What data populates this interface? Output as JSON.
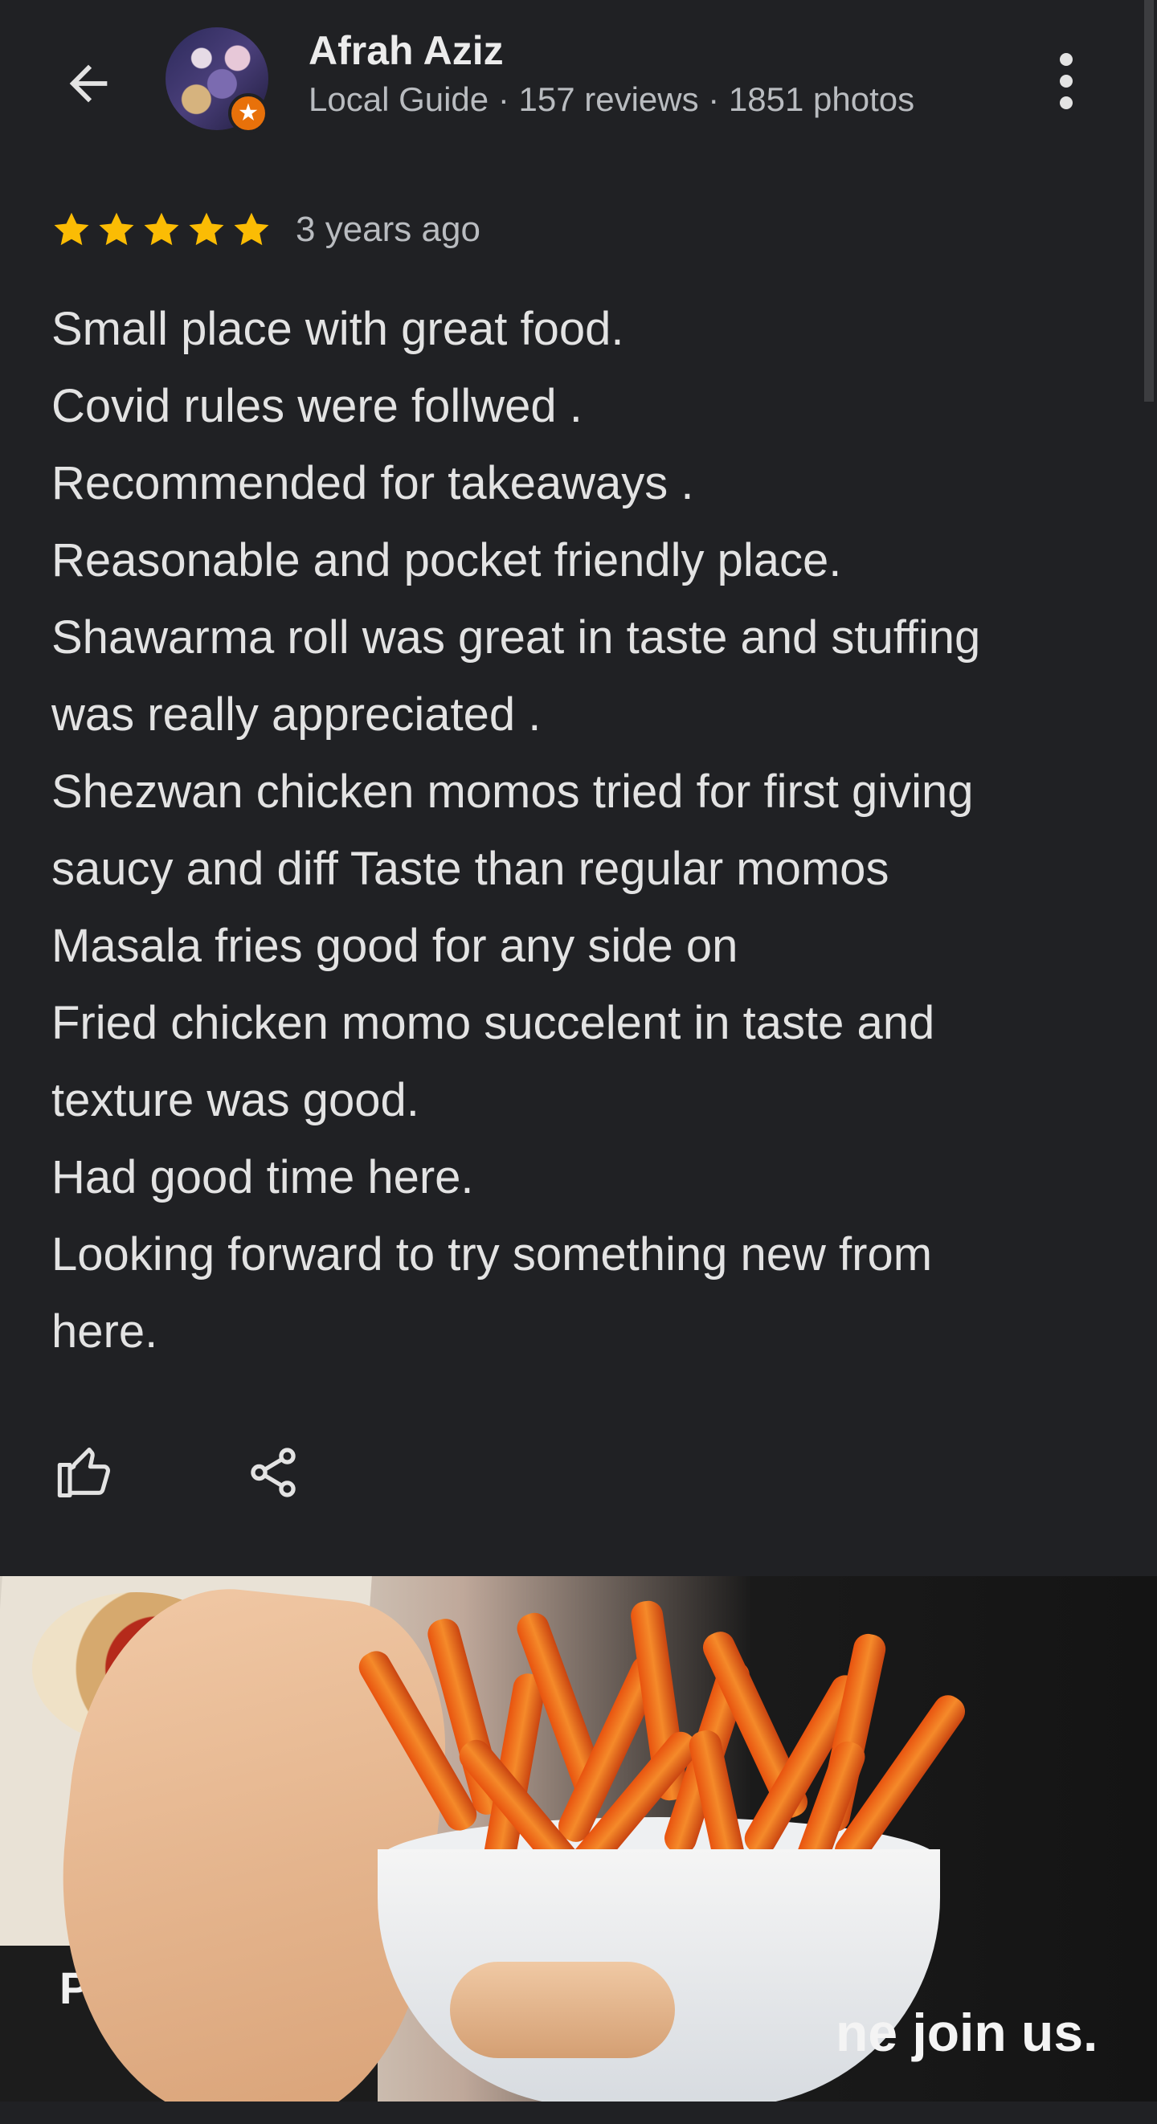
{
  "header": {
    "name": "Afrah Aziz",
    "subtitle": "Local Guide · 157 reviews · 1851 photos"
  },
  "review": {
    "rating": 5,
    "max_rating": 5,
    "age": "3 years ago",
    "lines": [
      "Small place with great food.",
      "Covid rules were follwed .",
      "Recommended for takeaways .",
      "Reasonable and pocket friendly place.",
      "Shawarma roll was great in taste and stuffing",
      "was really appreciated .",
      "Shezwan chicken momos tried for first giving",
      "saucy and diff Taste than regular momos",
      "Masala fries good for any side on",
      "Fried chicken momo succelent in taste and",
      "texture was good.",
      "Had good time here.",
      "Looking forward to try something new from",
      "here."
    ]
  },
  "photo": {
    "visible_text_left": "Pull",
    "visible_text_right": "ne join us."
  },
  "colors": {
    "background": "#202124",
    "star": "#fbbc04",
    "badge": "#e8710a"
  },
  "icons": {
    "back": "arrow-left-icon",
    "more": "more-vert-icon",
    "like": "thumb-up-icon",
    "share": "share-icon",
    "badge": "local-guide-badge-icon"
  }
}
